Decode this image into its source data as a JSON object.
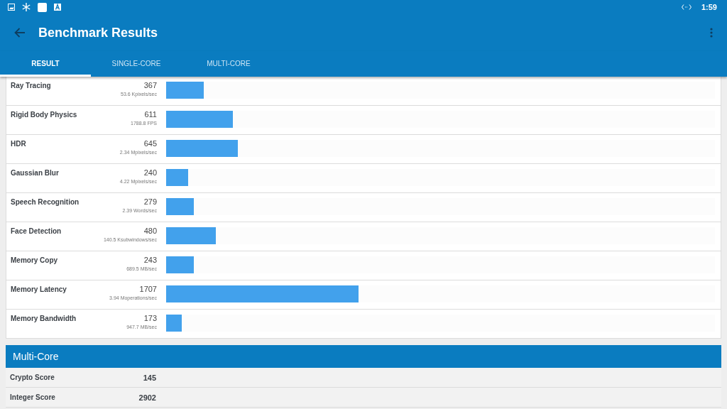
{
  "status_bar": {
    "time": "1:59"
  },
  "app_bar": {
    "title": "Benchmark Results"
  },
  "tabs": [
    {
      "label": "RESULT",
      "selected": true
    },
    {
      "label": "SINGLE-CORE",
      "selected": false
    },
    {
      "label": "MULTI-CORE",
      "selected": false
    }
  ],
  "single_core_rows": [
    {
      "name": "Ray Tracing",
      "score": "367",
      "rate": "53.6 Kpixels/sec",
      "level": 0.069
    },
    {
      "name": "Rigid Body Physics",
      "score": "611",
      "rate": "1788.8 FPS",
      "level": 0.121
    },
    {
      "name": "HDR",
      "score": "645",
      "rate": "2.34 Mpixels/sec",
      "level": 0.131
    },
    {
      "name": "Gaussian Blur",
      "score": "240",
      "rate": "4.22 Mpixels/sec",
      "level": 0.04
    },
    {
      "name": "Speech Recognition",
      "score": "279",
      "rate": "2.39 Words/sec",
      "level": 0.05
    },
    {
      "name": "Face Detection",
      "score": "480",
      "rate": "140.5 Ksubwindows/sec",
      "level": 0.091
    },
    {
      "name": "Memory Copy",
      "score": "243",
      "rate": "689.5 MB/sec",
      "level": 0.05
    },
    {
      "name": "Memory Latency",
      "score": "1707",
      "rate": "3.94 Moperations/sec",
      "level": 0.35
    },
    {
      "name": "Memory Bandwidth",
      "score": "173",
      "rate": "947.7 MB/sec",
      "level": 0.029
    }
  ],
  "multi_core": {
    "title": "Multi-Core",
    "rows": [
      {
        "name": "Crypto Score",
        "score": "145"
      },
      {
        "name": "Integer Score",
        "score": "2902"
      }
    ]
  }
}
